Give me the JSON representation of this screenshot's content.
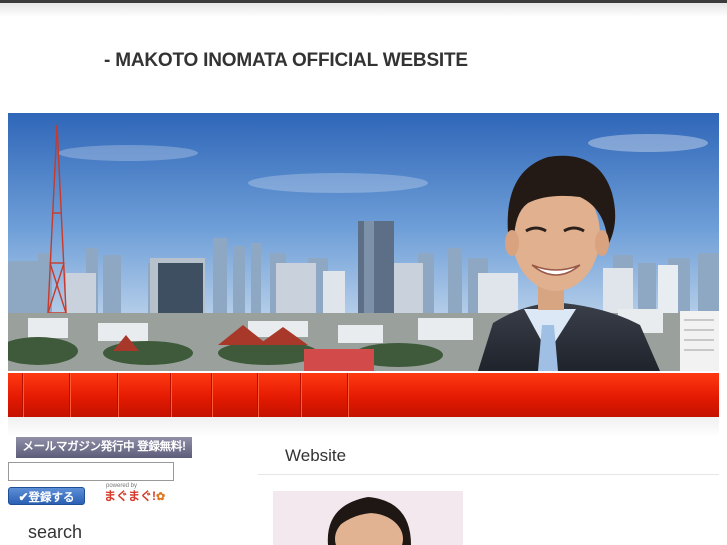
{
  "site": {
    "title": "- MAKOTO INOMATA OFFICIAL WEBSITE"
  },
  "nav": {
    "items": [
      "",
      "",
      "",
      "",
      "",
      "",
      "",
      "",
      ""
    ]
  },
  "sidebar": {
    "mailmag_banner": "メールマガジン発行中 登録無料!",
    "email_value": "",
    "register_button": "登録する",
    "powered_by": "powered by",
    "mag_logo": "まぐまぐ!",
    "search_heading": "search"
  },
  "main": {
    "heading": "Website"
  },
  "colors": {
    "nav_red": "#e41a02",
    "register_blue": "#2a5fb4",
    "banner_sky": "#3f78c6"
  }
}
